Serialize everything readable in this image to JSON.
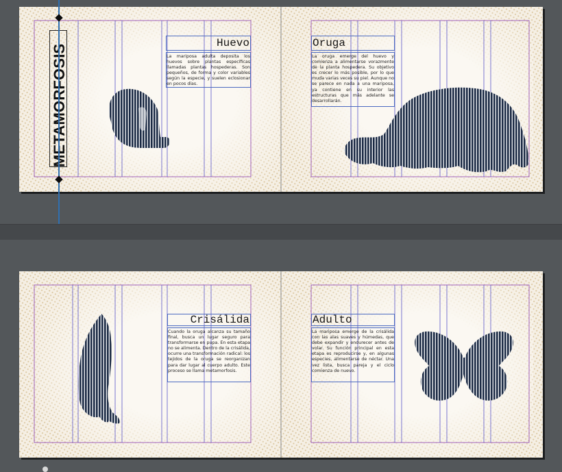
{
  "document": {
    "vertical_title": "METAMORFOSIS",
    "spreads": [
      {
        "pages": [
          {
            "heading": "Huevo",
            "body": "La mariposa adulta deposita los huevos sobre plantas específicas llamadas plantas hospederas. Son pequeños, de forma y color variables según la especie, y suelen eclosionar en pocos días."
          },
          {
            "heading": "Oruga",
            "body": "La oruga emerge del huevo y comienza a alimentarse vorazmente de la planta hospedera. Su objetivo es crecer lo más posible, por lo que muda varias veces su piel. Aunque no se parece en nada a una mariposa, ya contiene en su interior las estructuras que más adelante se desarrollarán."
          }
        ]
      },
      {
        "pages": [
          {
            "heading": "Crisálida",
            "body": "Cuando la oruga alcanza su tamaño final, busca un lugar seguro para transformarse en pupa. En esta etapa no se alimenta. Dentro de la crisálida, ocurre una transformación radical: los tejidos de la oruga se reorganizan para dar lugar al cuerpo adulto. Este proceso se llama metamorfosis."
          },
          {
            "heading": "Adulto",
            "body": "La mariposa emerge de la crisálida con las alas suaves y húmedas, que debe expandir y endurecer antes de volar. Su función principal en esta etapa es reproducirse y, en algunas especies, alimentarse de néctar. Una vez lista, busca pareja y el ciclo comienza de nuevo."
          }
        ]
      }
    ],
    "illustrations": [
      "egg",
      "caterpillar",
      "chrysalis",
      "butterfly"
    ]
  },
  "colors": {
    "pasteboard": "#53575a",
    "page": "#f6f1e8",
    "texture": "#d9c29a",
    "margin_guide": "#8c3fb0",
    "column_guide": "#5a55c8",
    "frame": "#4a69c0",
    "illustration": "#1b2a44"
  }
}
